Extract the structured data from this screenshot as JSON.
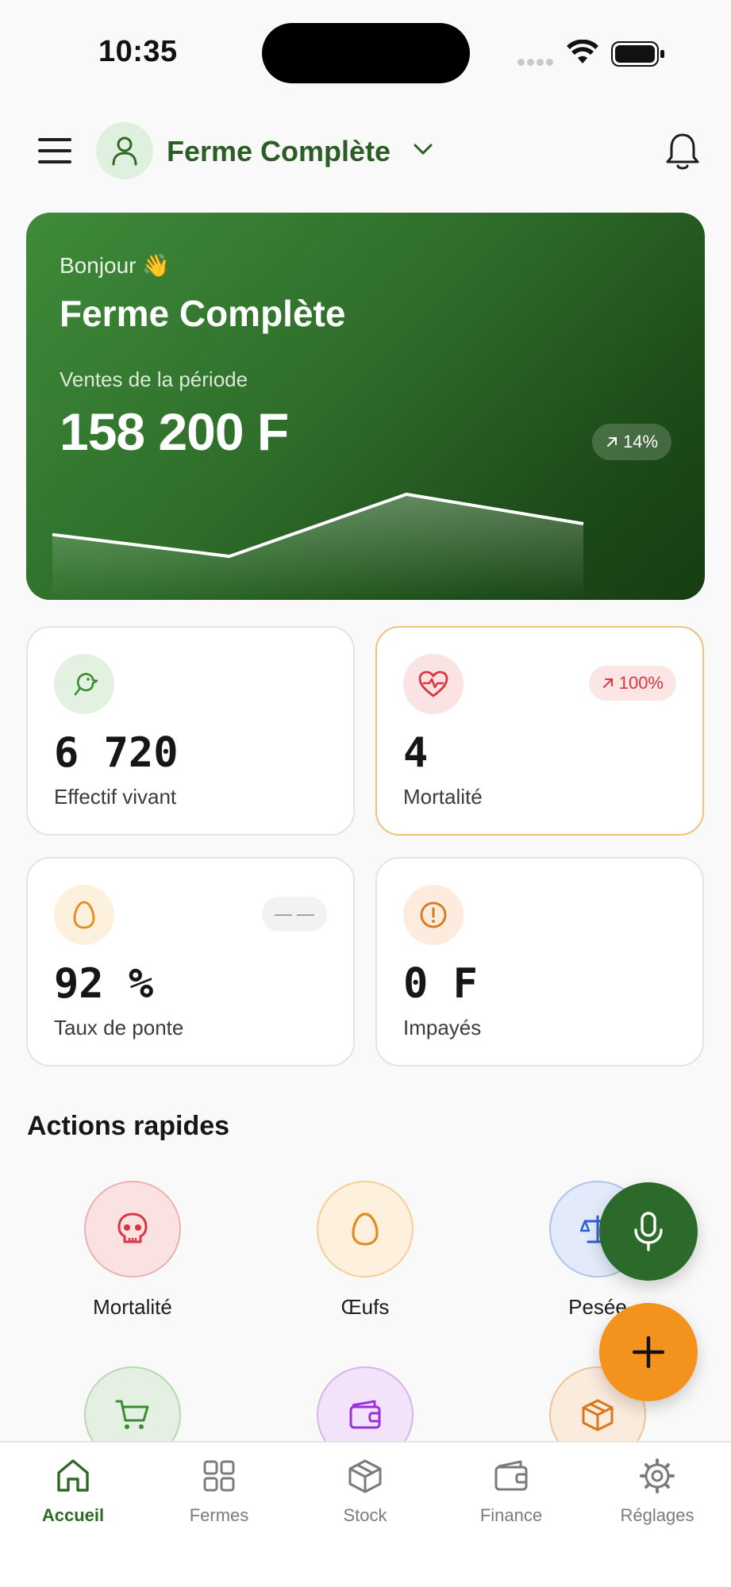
{
  "status_bar": {
    "time": "10:35"
  },
  "header": {
    "farm_name": "Ferme Complète"
  },
  "hero": {
    "greeting": "Bonjour 👋",
    "farm_name": "Ferme Complète",
    "sales_label": "Ventes de la période",
    "sales_value": "158 200 F",
    "trend_badge": "14%",
    "sparkline": [
      0.25,
      0.05,
      0.62,
      0.35
    ]
  },
  "kpis": {
    "livestock": {
      "value": "6 720",
      "label": "Effectif vivant"
    },
    "mortality": {
      "value": "4",
      "label": "Mortalité",
      "badge": "100%"
    },
    "laying": {
      "value": "92 %",
      "label": "Taux de ponte",
      "badge": "— —"
    },
    "unpaid": {
      "value": "0 F",
      "label": "Impayés"
    }
  },
  "quick_actions": {
    "title": "Actions rapides",
    "items": [
      {
        "label": "Mortalité",
        "icon": "skull-icon"
      },
      {
        "label": "Œufs",
        "icon": "egg-icon"
      },
      {
        "label": "Pesée",
        "icon": "scale-icon"
      },
      {
        "label": "",
        "icon": "cart-icon"
      },
      {
        "label": "",
        "icon": "wallet-icon"
      },
      {
        "label": "",
        "icon": "box-icon"
      }
    ]
  },
  "bottom_nav": {
    "items": [
      {
        "label": "Accueil",
        "icon": "home-icon",
        "active": true
      },
      {
        "label": "Fermes",
        "icon": "grid-icon"
      },
      {
        "label": "Stock",
        "icon": "package-icon"
      },
      {
        "label": "Finance",
        "icon": "wallet-icon"
      },
      {
        "label": "Réglages",
        "icon": "gear-icon"
      }
    ]
  },
  "colors": {
    "brand_green": "#2b6a2a",
    "accent_orange": "#f4921e",
    "alert_red": "#d9363e"
  }
}
